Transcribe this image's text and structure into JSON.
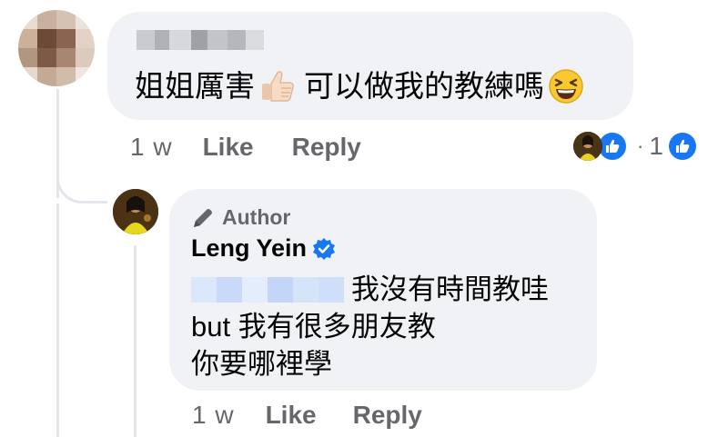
{
  "comment": {
    "author_name_blurred": "",
    "text": "姐姐厲害👍🏻 可以做我的教練嗎😆",
    "text_main": "姐姐厲害",
    "text_after": "可以做我的教練嗎",
    "time": "1 w",
    "like_label": "Like",
    "reply_label": "Reply",
    "reaction_count": "1",
    "reaction_separator": "·"
  },
  "reply": {
    "badge_label": "Author",
    "author_name": "Leng Yein",
    "line1": "我沒有時間教哇",
    "line2": "but 我有很多朋友教",
    "line3": "你要哪裡學",
    "time": "1 w",
    "like_label": "Like",
    "reply_label": "Reply"
  },
  "icons": {
    "thumbs_up": "thumbs-up-emoji",
    "grin": "grinning-squinting-face-emoji",
    "pencil": "pencil-icon",
    "verified": "verified-badge-icon",
    "like_reaction": "like-reaction-icon"
  },
  "colors": {
    "bubble_bg": "#f0f2f5",
    "meta_gray": "#65676b",
    "fb_blue": "#1877f2",
    "text": "#050505"
  }
}
